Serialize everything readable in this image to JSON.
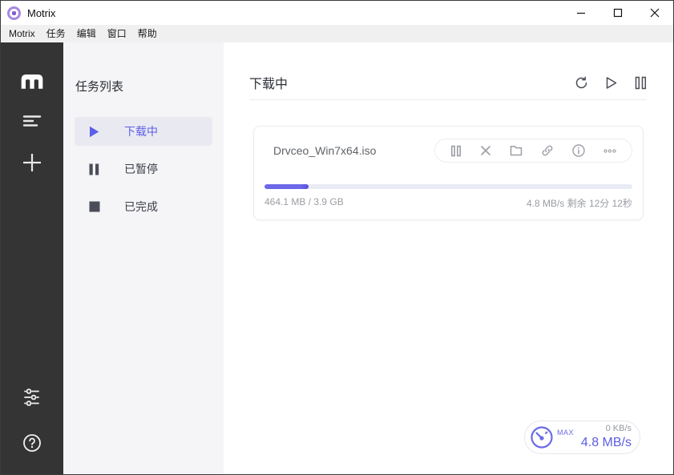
{
  "titlebar": {
    "app_title": "Motrix",
    "controls": [
      "minimize",
      "maximize",
      "close"
    ]
  },
  "menubar": {
    "items": [
      "Motrix",
      "任务",
      "编辑",
      "窗口",
      "帮助"
    ]
  },
  "rail": {
    "icons": [
      "motrix-logo",
      "task-list",
      "add-task",
      "settings-sliders",
      "help"
    ]
  },
  "task_sidebar": {
    "title": "任务列表",
    "items": [
      {
        "label": "下载中",
        "icon": "play",
        "active": true
      },
      {
        "label": "已暂停",
        "icon": "pause",
        "active": false
      },
      {
        "label": "已完成",
        "icon": "stop",
        "active": false
      }
    ]
  },
  "main": {
    "header_title": "下载中",
    "header_icons": [
      "refresh",
      "resume-all",
      "pause-all"
    ],
    "task": {
      "filename": "Drvceo_Win7x64.iso",
      "progress_percent": 12,
      "size_text": "464.1 MB / 3.9 GB",
      "speed_text": "4.8 MB/s 剩余 12分 12秒",
      "action_icons": [
        "pause",
        "delete",
        "open-folder",
        "copy-link",
        "info",
        "more"
      ]
    },
    "speed_widget": {
      "max_label": "MAX",
      "upload_speed": "0 KB/s",
      "download_speed": "4.8 MB/s"
    }
  },
  "colors": {
    "accent": "#5d5fe8",
    "progress_fill": "#6b68ea",
    "progress_track": "#e9ebf5",
    "rail_bg": "#343434",
    "sidebar_bg": "#f5f5f7",
    "active_item_bg": "#e9eaf1",
    "dark_icon": "#4b4e59"
  }
}
